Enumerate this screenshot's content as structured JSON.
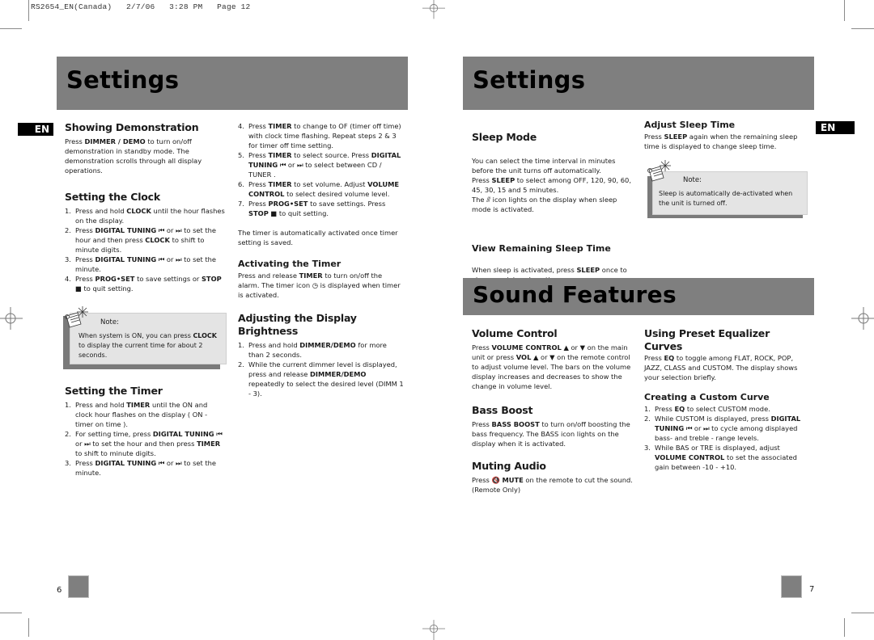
{
  "slug": "RS2654_EN(Canada)   2/7/06   3:28 PM   Page 12",
  "left_page": {
    "banner_title": "Settings",
    "language_tab": "EN",
    "page_number": "6",
    "sections": {
      "demo": {
        "title": "Showing Demonstration",
        "body": [
          "Press ",
          "DIMMER / DEMO",
          " to turn on/off demonstration in standby mode. The demonstration scrolls through all display operations."
        ]
      },
      "clock": {
        "title": "Setting the Clock",
        "steps": [
          {
            "n": "1.",
            "parts": [
              "Press and hold ",
              "CLOCK",
              " until the hour flashes on the display."
            ]
          },
          {
            "n": "2.",
            "parts": [
              "Press ",
              "DIGITAL TUNING",
              " ⏮ or ⏭ to set the hour and then press ",
              "CLOCK",
              " to shift to minute digits."
            ]
          },
          {
            "n": "3.",
            "parts": [
              "Press ",
              "DIGITAL TUNING",
              " ⏮ or ⏭ to set the minute."
            ]
          },
          {
            "n": "4.",
            "parts": [
              "Press ",
              "PROG•SET",
              " to save settings or ",
              "STOP",
              " ■ to quit setting."
            ]
          }
        ]
      },
      "note_clock": {
        "label": "Note:",
        "text_parts": [
          "When system is ON, you can press ",
          "CLOCK",
          " to display the current time for about 2 seconds."
        ]
      },
      "timer": {
        "title": "Setting the Timer",
        "steps": [
          {
            "n": "1.",
            "parts": [
              "Press and hold ",
              "TIMER",
              " until the ON and clock hour flashes on the display ( ON  - timer on time )."
            ]
          },
          {
            "n": "2.",
            "parts": [
              "For setting time, press ",
              "DIGITAL TUNING",
              " ⏮ or ⏭ to set the hour and then press ",
              "TIMER",
              " to shift to minute digits."
            ]
          },
          {
            "n": "3.",
            "parts": [
              "Press ",
              "DIGITAL TUNING",
              " ⏮ or ⏭ to set the minute."
            ]
          },
          {
            "n": "4.",
            "parts": [
              "Press ",
              "TIMER",
              " to change to OF (timer off time) with clock time flashing. Repeat steps 2 & 3 for timer off time setting."
            ]
          },
          {
            "n": "5.",
            "parts": [
              "Press ",
              "TIMER",
              " to select source.  Press ",
              "DIGITAL TUNING",
              " ⏮ or ⏭ to select between CD / TUNER ."
            ]
          },
          {
            "n": "6.",
            "parts": [
              "Press ",
              "TIMER",
              " to set volume.  Adjust ",
              "VOLUME CONTROL",
              " to select desired volume level."
            ]
          },
          {
            "n": "7.",
            "parts": [
              "Press ",
              "PROG•SET",
              " to save settings. Press ",
              "STOP",
              " ■  to quit setting."
            ]
          }
        ],
        "footer": "The timer is automatically activated once timer setting is saved."
      },
      "activate_timer": {
        "title": "Activating the Timer",
        "parts": [
          "Press and release ",
          "TIMER",
          " to turn on/off the alarm. The timer icon ◷ is displayed when timer is activated."
        ]
      },
      "brightness": {
        "title": "Adjusting the Display Brightness",
        "steps": [
          {
            "n": "1.",
            "parts": [
              "Press and hold ",
              "DIMMER/DEMO",
              " for more than 2 seconds."
            ]
          },
          {
            "n": "2.",
            "parts": [
              "While the current dimmer level is displayed, press and release ",
              "DIMMER/DEMO",
              " repeatedly to select the desired level (DIMM 1 - 3)."
            ]
          }
        ]
      }
    }
  },
  "right_page": {
    "banner_title": "Settings",
    "sound_banner_title": "Sound Features",
    "language_tab": "EN",
    "page_number": "7",
    "sections": {
      "sleep": {
        "title": "Sleep Mode",
        "parts": [
          "You can select the time interval in minutes before the unit turns off automatically.\nPress ",
          "SLEEP",
          " to select among OFF, 120, 90, 60, 45, 30, 15 and  5 minutes.\nThe  ⫻ icon lights on the display when sleep mode is activated."
        ]
      },
      "view_sleep": {
        "title": "View Remaining Sleep Time",
        "parts": [
          "When sleep is activated, press ",
          "SLEEP",
          " once to view remaining sleep time."
        ]
      },
      "adjust_sleep": {
        "title": "Adjust Sleep Time",
        "parts": [
          "Press ",
          "SLEEP",
          " again when the remaining sleep time is displayed to change sleep time."
        ]
      },
      "note_sleep": {
        "label": "Note:",
        "text": "Sleep is automatically de-activated when the unit is turned off."
      },
      "volume": {
        "title": "Volume Control",
        "parts": [
          "Press ",
          "VOLUME CONTROL",
          " ▲ or ▼ on the main unit or press ",
          "VOL",
          " ▲ or ▼  on the remote control to adjust volume level. The bars on the volume display increases and decreases to show the change in volume level."
        ]
      },
      "bass": {
        "title": "Bass Boost",
        "parts": [
          "Press ",
          "BASS BOOST",
          "  to turn on/off boosting the bass frequency. The BASS icon lights on the display when it is activated."
        ]
      },
      "mute": {
        "title": "Muting Audio",
        "parts": [
          "Press 🔇 ",
          "MUTE",
          " on the remote to cut the sound. (Remote Only)"
        ]
      },
      "eq": {
        "title": "Using Preset Equalizer Curves",
        "parts": [
          "Press ",
          "EQ",
          " to toggle among FLAT, ROCK, POP, JAZZ, CLASS and CUSTOM.  The display shows your selection briefly."
        ]
      },
      "custom": {
        "title": "Creating a Custom Curve",
        "steps": [
          {
            "n": "1.",
            "parts": [
              "Press ",
              "EQ",
              " to select CUSTOM mode."
            ]
          },
          {
            "n": "2.",
            "parts": [
              "While CUSTOM is displayed, press ",
              "DIGITAL TUNING",
              "  ⏮ or ⏭  to cycle  among displayed bass-  and treble - range levels."
            ]
          },
          {
            "n": "3.",
            "parts": [
              "While BAS or TRE is displayed, adjust ",
              "VOLUME CONTROL",
              " to set the associated gain between -10 - +10."
            ]
          }
        ]
      }
    }
  }
}
